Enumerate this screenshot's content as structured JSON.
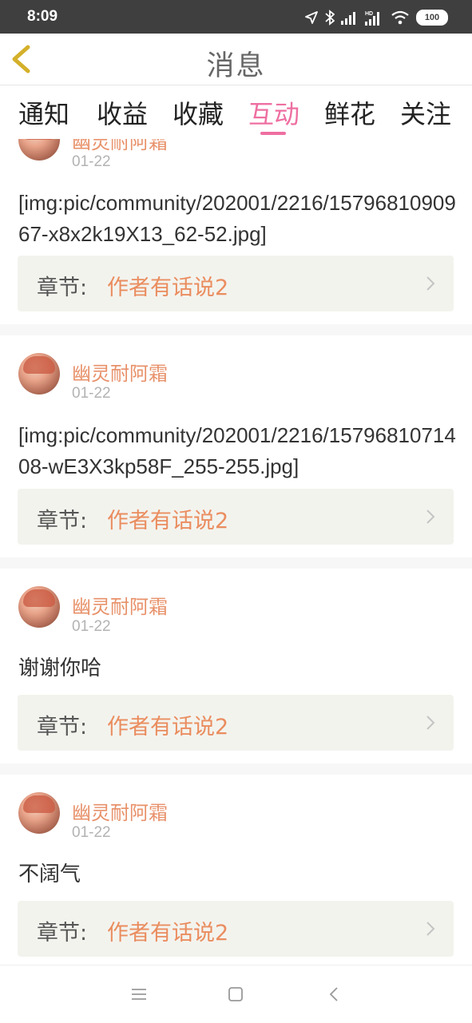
{
  "status_bar": {
    "time": "8:09",
    "battery": "100",
    "icons": [
      "location-icon",
      "bluetooth-icon",
      "signal-icon",
      "hd-signal-icon",
      "wifi-icon",
      "battery-icon"
    ]
  },
  "nav": {
    "title": "消息",
    "back_icon": "back-chevron-icon",
    "accent_color": "#d4b02a"
  },
  "tabs": [
    {
      "label": "通知",
      "active": false
    },
    {
      "label": "收益",
      "active": false
    },
    {
      "label": "收藏",
      "active": false
    },
    {
      "label": "互动",
      "active": true
    },
    {
      "label": "鲜花",
      "active": false
    },
    {
      "label": "关注",
      "active": false
    }
  ],
  "colors": {
    "active_tab": "#ee6fa1",
    "username": "#e8916a",
    "chapter_value": "#ea8d5f",
    "chapter_bg": "#f3f3ee"
  },
  "messages": [
    {
      "username": "幽灵耐阿霜",
      "date": "01-22",
      "content": "[img:pic/community/202001/2216/1579681090967-x8x2k19X13_62-52.jpg]",
      "chapter_label": "章节:",
      "chapter_value": "作者有话说2"
    },
    {
      "username": "幽灵耐阿霜",
      "date": "01-22",
      "content": "[img:pic/community/202001/2216/1579681071408-wE3X3kp58F_255-255.jpg]",
      "chapter_label": "章节:",
      "chapter_value": "作者有话说2"
    },
    {
      "username": "幽灵耐阿霜",
      "date": "01-22",
      "content": "谢谢你哈",
      "chapter_label": "章节:",
      "chapter_value": "作者有话说2"
    },
    {
      "username": "幽灵耐阿霜",
      "date": "01-22",
      "content": "不阔气",
      "chapter_label": "章节:",
      "chapter_value": "作者有话说2"
    }
  ],
  "bottom_nav": [
    "menu-icon",
    "home-square-icon",
    "back-icon"
  ]
}
